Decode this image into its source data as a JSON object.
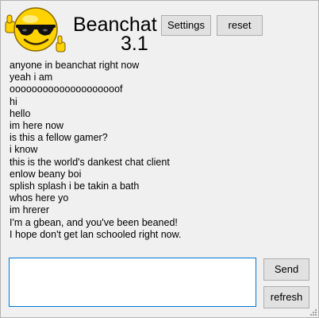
{
  "header": {
    "title": "Beanchat",
    "version": "3.1",
    "logo_icon": "cool-sunglasses-thumbs-up-smiley-icon"
  },
  "toolbar": {
    "settings_label": "Settings",
    "reset_label": "reset"
  },
  "messages": [
    "anyone in beanchat right now",
    "yeah i am",
    "oooooooooooooooooooof",
    "hi",
    "hello",
    "im here now",
    "is this a fellow gamer?",
    "i know",
    "this is the world's dankest chat client",
    "enlow beany boi",
    "splish splash i be takin a bath",
    "whos here yo",
    "im hrerer",
    "I'm a gbean, and you've been beaned!",
    "I hope don't get lan schooled right now."
  ],
  "composer": {
    "value": "",
    "send_label": "Send",
    "refresh_label": "refresh"
  },
  "colors": {
    "window_background": "#f0f0f0",
    "button_background": "#e1e1e1",
    "input_focus_border": "#0078d7",
    "smiley_yellow": "#ffd200"
  }
}
